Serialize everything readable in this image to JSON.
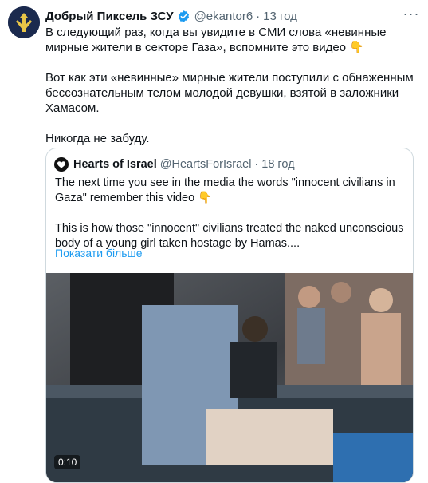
{
  "tweet": {
    "display_name": "Добрый Пиксель ЗСУ",
    "handle": "@ekantor6",
    "separator": "·",
    "time": "13 год",
    "more_label": "···",
    "text_p1": "В следующий раз, когда вы увидите в СМИ слова «невинные мирные жители в секторе Газа», вспомните это видео",
    "text_p2": "Вот как эти «невинные» мирные жители поступили с обнаженным бессознательным телом молодой девушки, взятой в заложники Хамасом.",
    "text_p3": "Никогда не забуду.",
    "emoji": "👇"
  },
  "quoted": {
    "display_name": "Hearts of Israel",
    "handle": "@HeartsForIsrael",
    "separator": "·",
    "time": "18 год",
    "text_p1": "The next time you see in the media the words \"innocent civilians in Gaza\" remember this video",
    "text_p2": "This is how those \"innocent\" civilians treated the naked unconscious body of a young girl taken hostage by Hamas....",
    "emoji": "👇",
    "show_more": "Показати більше",
    "video_duration": "0:10"
  },
  "colors": {
    "link": "#1d9bf0",
    "secondary_text": "#536471",
    "border": "#cfd9de",
    "verified": "#1d9bf0"
  }
}
